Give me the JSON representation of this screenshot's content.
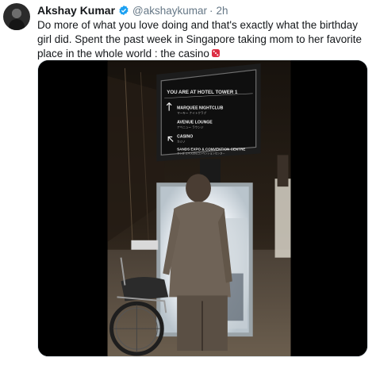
{
  "tweet": {
    "author_name": "Akshay Kumar",
    "handle": "@akshaykumar",
    "separator": "·",
    "time": "2h",
    "text": "Do more of what you love doing and that's exactly what the birthday girl did. Spent the past week in Singapore taking mom to her favorite place in the whole world : the casino"
  },
  "media": {
    "sign": {
      "header": "YOU ARE AT HOTEL TOWER 1",
      "items": [
        {
          "title": "MARQUEE NIGHTCLUB",
          "sub": "マーキー ナイトクラブ"
        },
        {
          "title": "AVENUE LOUNGE",
          "sub": "アベニュー ラウンジ"
        },
        {
          "title": "CASINO",
          "sub": "カジノ"
        },
        {
          "title": "SANDS EXPO & CONVENTION CENTRE",
          "sub": "サンズ エキスポ&コンベンションセンター"
        }
      ]
    }
  },
  "colors": {
    "verified": "#1da1f2",
    "secondary_text": "#657786"
  },
  "icons": [
    "verified-badge-icon",
    "dice-emoji-icon"
  ]
}
